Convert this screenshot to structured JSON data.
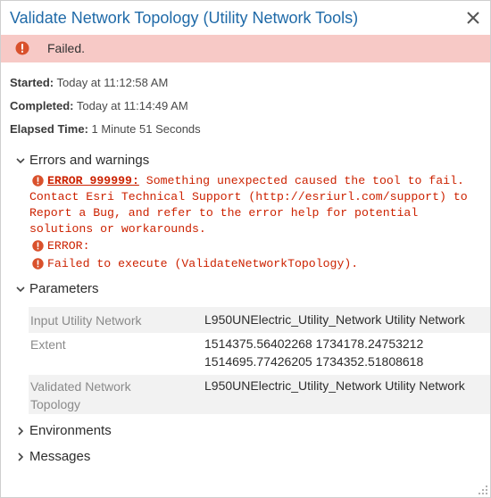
{
  "window": {
    "title": "Validate Network Topology (Utility Network Tools)",
    "close_icon": "close-icon"
  },
  "status": {
    "text": "Failed.",
    "icon": "error-circle-icon",
    "background": "#f7c9c6"
  },
  "info": {
    "started_label": "Started:",
    "started_value": " Today at 11:12:58 AM",
    "completed_label": "Completed:",
    "completed_value": " Today at 11:14:49 AM",
    "elapsed_label": "Elapsed Time:",
    "elapsed_value": " 1 Minute 51 Seconds"
  },
  "sections": {
    "errors": "Errors and warnings",
    "parameters": "Parameters",
    "environments": "Environments",
    "messages": "Messages"
  },
  "errors": [
    {
      "code": "ERROR 999999:",
      "lines": [
        " Something unexpected caused the tool to fail.",
        "Contact Esri Technical Support (http://esriurl.com/support) to",
        "Report a Bug, and refer to the error help for potential",
        "solutions or workarounds."
      ]
    },
    {
      "text": "ERROR:"
    },
    {
      "text": "Failed to execute (ValidateNetworkTopology)."
    }
  ],
  "parameters": [
    {
      "label": "Input Utility Network",
      "value": "L950UNElectric_Utility_Network Utility Network"
    },
    {
      "label": "Extent",
      "value_lines": [
        "1514375.56402268 1734178.24753212",
        "1514695.77426205 1734352.51808618"
      ]
    },
    {
      "label_lines": [
        "Validated Network",
        "Topology"
      ],
      "value": "L950UNElectric_Utility_Network Utility Network"
    }
  ],
  "colors": {
    "title": "#1f6aa8",
    "error_text": "#cc2200",
    "error_icon": "#d9512c"
  }
}
